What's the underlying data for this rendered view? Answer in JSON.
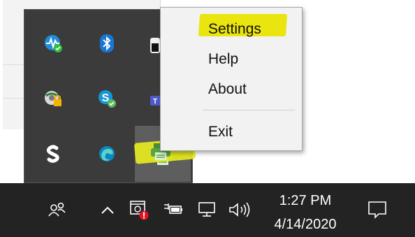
{
  "context_menu": {
    "items": [
      {
        "label": "Settings",
        "highlighted": true
      },
      {
        "label": "Help"
      },
      {
        "label": "About"
      },
      {
        "label": "Exit"
      }
    ]
  },
  "tray_overflow": {
    "icons": [
      "network-monitor-icon",
      "bluetooth-icon",
      "partially-hidden-icon",
      "vpn-lock-icon",
      "skype-icon",
      "teams-icon",
      "s-app-icon",
      "edge-beta-icon",
      "printer-app-icon"
    ],
    "selected_icon": "printer-app-icon"
  },
  "taskbar": {
    "time": "1:27 PM",
    "date": "4/14/2020",
    "icons": [
      "people-icon",
      "show-hidden-icons-chevron",
      "security-alert-icon",
      "battery-charging-icon",
      "network-icon",
      "volume-icon",
      "action-center-icon"
    ]
  },
  "colors": {
    "highlight": "#f7f20f",
    "taskbar": "#232323",
    "flyout": "#3b3b3b",
    "menu": "#f2f2f2"
  }
}
